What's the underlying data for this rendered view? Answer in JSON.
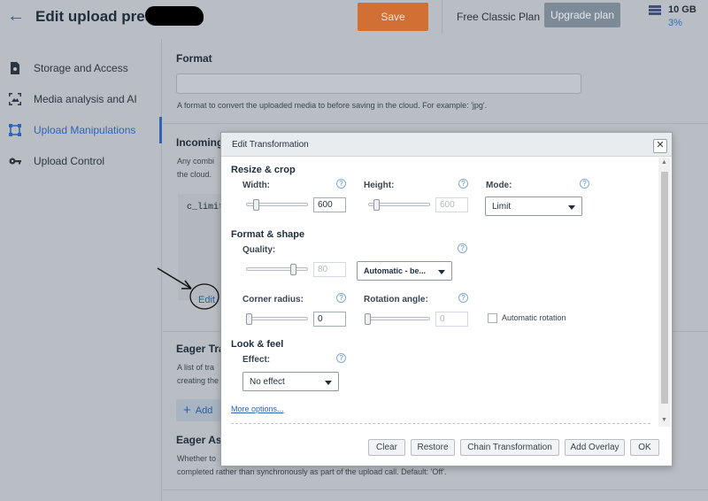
{
  "header": {
    "title": "Edit upload preset:",
    "save_label": "Save",
    "plan_label": "Free Classic Plan",
    "upgrade_label": "Upgrade plan",
    "storage_amount": "10 GB",
    "storage_percent": "3%"
  },
  "sidebar": {
    "items": [
      {
        "label": "Storage and Access",
        "icon": "file-gear-icon",
        "active": false
      },
      {
        "label": "Media analysis and AI",
        "icon": "image-scan-icon",
        "active": false
      },
      {
        "label": "Upload Manipulations",
        "icon": "crop-frame-icon",
        "active": true
      },
      {
        "label": "Upload Control",
        "icon": "key-icon",
        "active": false
      }
    ]
  },
  "main": {
    "format": {
      "title": "Format",
      "value": "",
      "help": "A format to convert the uploaded media to before saving in the cloud. For example: 'jpg'."
    },
    "incoming": {
      "title": "Incoming",
      "help_line1": "Any combi",
      "help_line2": "the cloud.",
      "code": "c_limit",
      "edit_label": "Edit"
    },
    "eager": {
      "title": "Eager Tran",
      "help_line1": "A list of tra",
      "help_line2": "creating the",
      "add_label": "Add"
    },
    "eager_async": {
      "title": "Eager Asyn",
      "help_line1": "Whether to",
      "help_line2": "completed rather than synchronously as part of the upload call. Default: 'Off'."
    }
  },
  "dialog": {
    "title": "Edit Transformation",
    "close_label": "✕",
    "resize": {
      "title": "Resize & crop",
      "width_label": "Width:",
      "width_value": "600",
      "width_slider": 0.12,
      "height_label": "Height:",
      "height_value": "600",
      "height_slider": 0.1,
      "mode_label": "Mode:",
      "mode_value": "Limit"
    },
    "format_shape": {
      "title": "Format & shape",
      "quality_label": "Quality:",
      "quality_value": "80",
      "quality_slider": 0.8,
      "quality_select": "Automatic - be...",
      "corner_label": "Corner radius:",
      "corner_value": "0",
      "corner_slider": 0,
      "rotation_label": "Rotation angle:",
      "rotation_value": "0",
      "rotation_slider": 0,
      "auto_rotation_label": "Automatic rotation"
    },
    "look_feel": {
      "title": "Look & feel",
      "effect_label": "Effect:",
      "effect_value": "No effect"
    },
    "more_options": "More options...",
    "footer": {
      "clear": "Clear",
      "restore": "Restore",
      "chain": "Chain Transformation",
      "overlay": "Add Overlay",
      "ok": "OK"
    }
  },
  "colors": {
    "accent": "#2f63b5",
    "save": "#d16f35",
    "overlay": "#b9bec4"
  }
}
